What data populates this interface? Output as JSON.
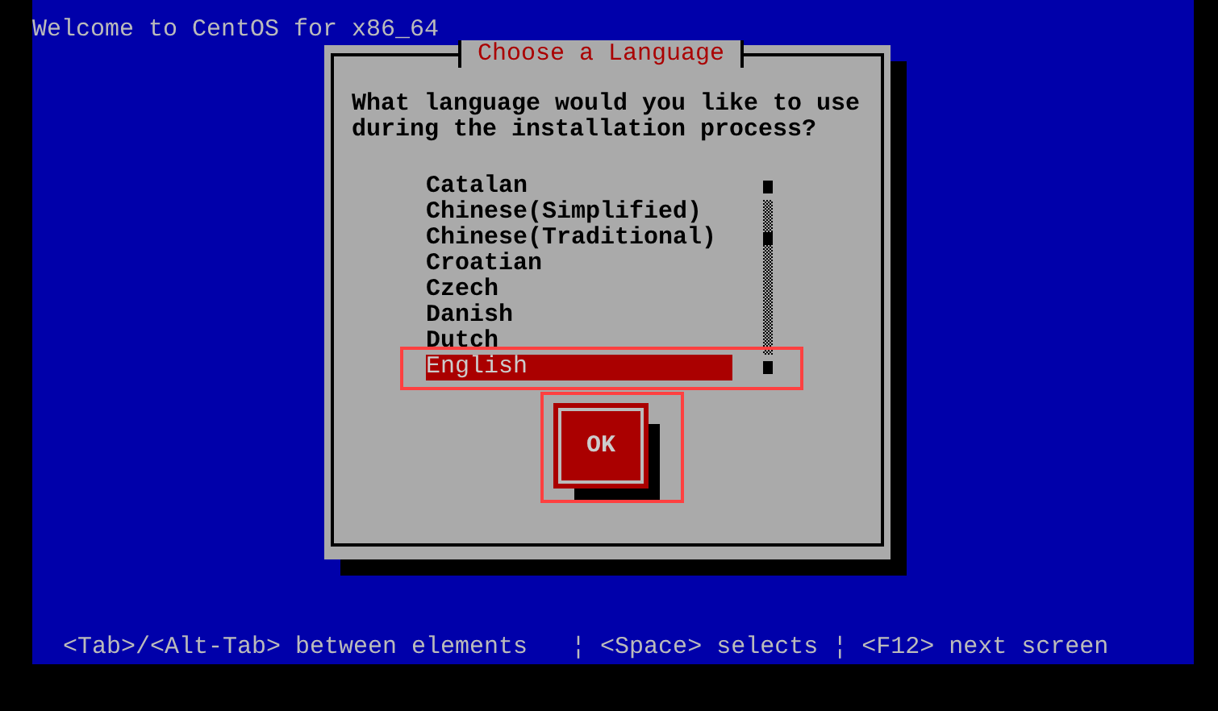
{
  "screen_title": "Welcome to CentOS for x86_64",
  "dialog": {
    "title": "Choose a Language",
    "prompt": "What language would you like to use during the installation process?",
    "languages": [
      {
        "label": "Catalan",
        "selected": false
      },
      {
        "label": "Chinese(Simplified)",
        "selected": false
      },
      {
        "label": "Chinese(Traditional)",
        "selected": false
      },
      {
        "label": "Croatian",
        "selected": false
      },
      {
        "label": "Czech",
        "selected": false
      },
      {
        "label": "Danish",
        "selected": false
      },
      {
        "label": "Dutch",
        "selected": false
      },
      {
        "label": "English",
        "selected": true
      }
    ],
    "buttons": [
      {
        "label": "OK",
        "focused": true
      }
    ]
  },
  "status_bar": "<Tab>/<Alt-Tab> between elements   ¦ <Space> selects ¦ <F12> next screen"
}
